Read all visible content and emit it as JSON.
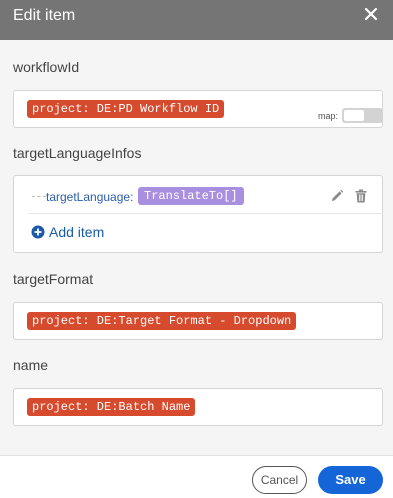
{
  "dialog": {
    "title": "Edit item"
  },
  "fields": {
    "workflowId": {
      "label": "workflowId",
      "value": "project: DE:PD Workflow ID"
    },
    "targetLanguageInfos": {
      "label": "targetLanguageInfos",
      "map_label": "map:",
      "map_enabled": false,
      "item": {
        "key": "targetLanguage:",
        "value": "TranslateTo[]"
      },
      "add_item_label": "Add item"
    },
    "targetFormat": {
      "label": "targetFormat",
      "value": "project: DE:Target Format - Dropdown"
    },
    "name": {
      "label": "name",
      "value": "project: DE:Batch Name"
    }
  },
  "footer": {
    "cancel_label": "Cancel",
    "save_label": "Save"
  },
  "colors": {
    "header_bg": "#757575",
    "project_pill": "#d64a2e",
    "variable_pill": "#a98fe0",
    "link_blue": "#1a5aa8",
    "save_button": "#1466d8"
  },
  "icons": [
    "close-icon",
    "edit-pencil-icon",
    "trash-icon",
    "add-circle-icon"
  ]
}
